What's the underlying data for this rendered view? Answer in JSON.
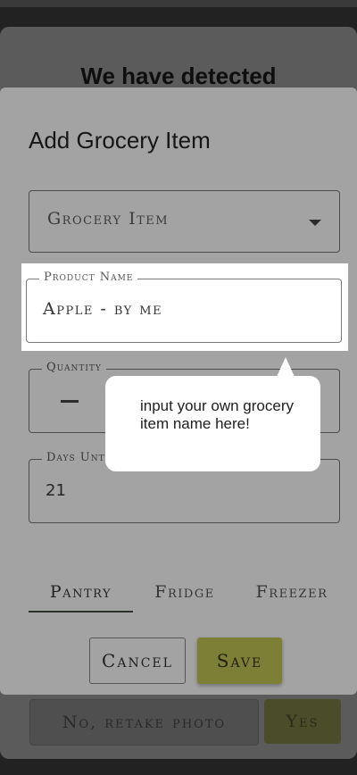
{
  "background": {
    "title": "We have detected",
    "retake_label": "No, retake photo",
    "yes_label": "Yes"
  },
  "dialog": {
    "title": "Add Grocery Item",
    "category_select": {
      "value": "Grocery Item"
    },
    "product_name": {
      "label": "Product Name",
      "value": "Apple - by me"
    },
    "quantity": {
      "label": "Quantity"
    },
    "days_until": {
      "label": "Days Unt",
      "value": "21"
    },
    "tabs": [
      {
        "label": "Pantry",
        "selected": true
      },
      {
        "label": "Fridge",
        "selected": false
      },
      {
        "label": "Freezer",
        "selected": false
      }
    ],
    "cancel_label": "Cancel",
    "save_label": "Save"
  },
  "tooltip": {
    "text": "input your own grocery item name here!"
  },
  "colors": {
    "save_button": "#7d7f37",
    "dialog_bg": "#a3a3a3",
    "tab_indicator": "#2c332a"
  },
  "icons": {
    "select_caret": "caret-down-icon",
    "quantity_decrement": "minus-icon"
  }
}
